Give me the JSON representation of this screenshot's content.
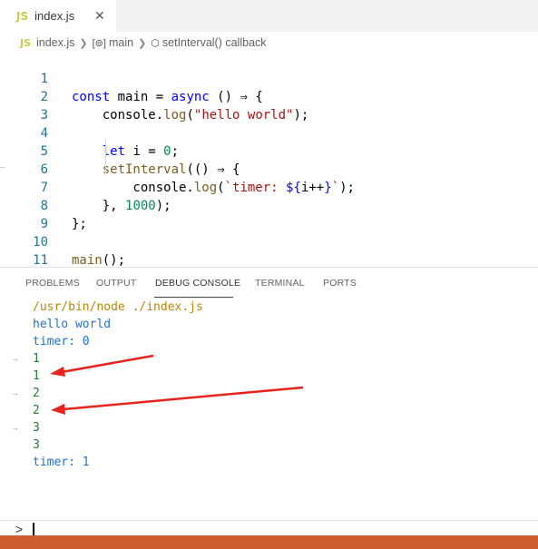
{
  "tab": {
    "icon": "JS",
    "filename": "index.js",
    "close_glyph": "✕"
  },
  "breadcrumb": {
    "icon": "JS",
    "items": [
      "index.js",
      "main",
      "setInterval() callback"
    ]
  },
  "code": {
    "line_numbers": [
      "1",
      "2",
      "3",
      "4",
      "5",
      "6",
      "7",
      "8",
      "9",
      "10",
      "11"
    ]
  },
  "panel": {
    "tabs": [
      "PROBLEMS",
      "OUTPUT",
      "DEBUG CONSOLE",
      "TERMINAL",
      "PORTS"
    ],
    "active_tab": "DEBUG CONSOLE"
  },
  "console": {
    "lines": [
      "/usr/bin/node ./index.js",
      "hello world",
      "timer: 0",
      "1",
      "1",
      "2",
      "2",
      "3",
      "3",
      "timer: 1"
    ]
  },
  "input": {
    "prompt": ">"
  },
  "colors": {
    "accent_status": "#cd5c2e",
    "annotation_arrow": "#e8231d"
  }
}
